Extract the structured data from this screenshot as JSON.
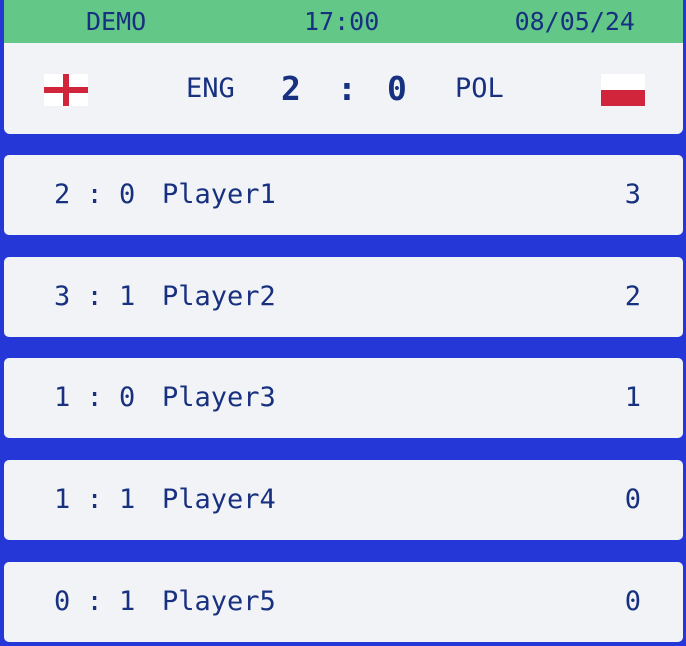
{
  "header": {
    "label": "DEMO",
    "time": "17:00",
    "date": "08/05/24"
  },
  "match": {
    "home_team": "ENG",
    "away_team": "POL",
    "home_score": "2",
    "separator": ":",
    "away_score": "0",
    "home_flag_icon": "england-flag-icon",
    "away_flag_icon": "poland-flag-icon"
  },
  "predictions": [
    {
      "tip": "2 : 0",
      "player": "Player1",
      "points": "3"
    },
    {
      "tip": "3 : 1",
      "player": "Player2",
      "points": "2"
    },
    {
      "tip": "1 : 0",
      "player": "Player3",
      "points": "1"
    },
    {
      "tip": "1 : 1",
      "player": "Player4",
      "points": "0"
    },
    {
      "tip": "0 : 1",
      "player": "Player5",
      "points": "0"
    }
  ],
  "colors": {
    "background": "#2537d6",
    "card": "#f2f3f6",
    "header_bar": "#63c887",
    "text": "#17307f",
    "england_red": "#d0253a",
    "poland_red": "#d0253a"
  }
}
